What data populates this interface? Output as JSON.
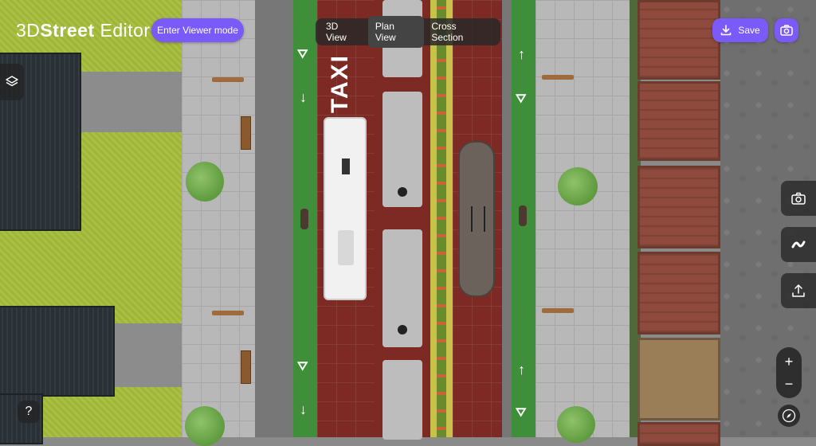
{
  "header": {
    "logo_prefix": "3D",
    "logo_bold": "Street",
    "logo_suffix": " Editor",
    "viewer_mode_label": "Enter Viewer mode",
    "save_label": "Save"
  },
  "view_tabs": {
    "tab_3d": "3D View",
    "tab_plan": "Plan View",
    "tab_cross": "Cross Section",
    "active": "Plan View"
  },
  "help": {
    "label": "?"
  },
  "zoom": {
    "in_label": "+",
    "out_label": "−"
  },
  "street": {
    "taxi_marking": "TAXI"
  },
  "colors": {
    "accent": "#7a5af8",
    "bus_lane": "#7d2a24",
    "bike_lane": "#3f8f3a"
  }
}
